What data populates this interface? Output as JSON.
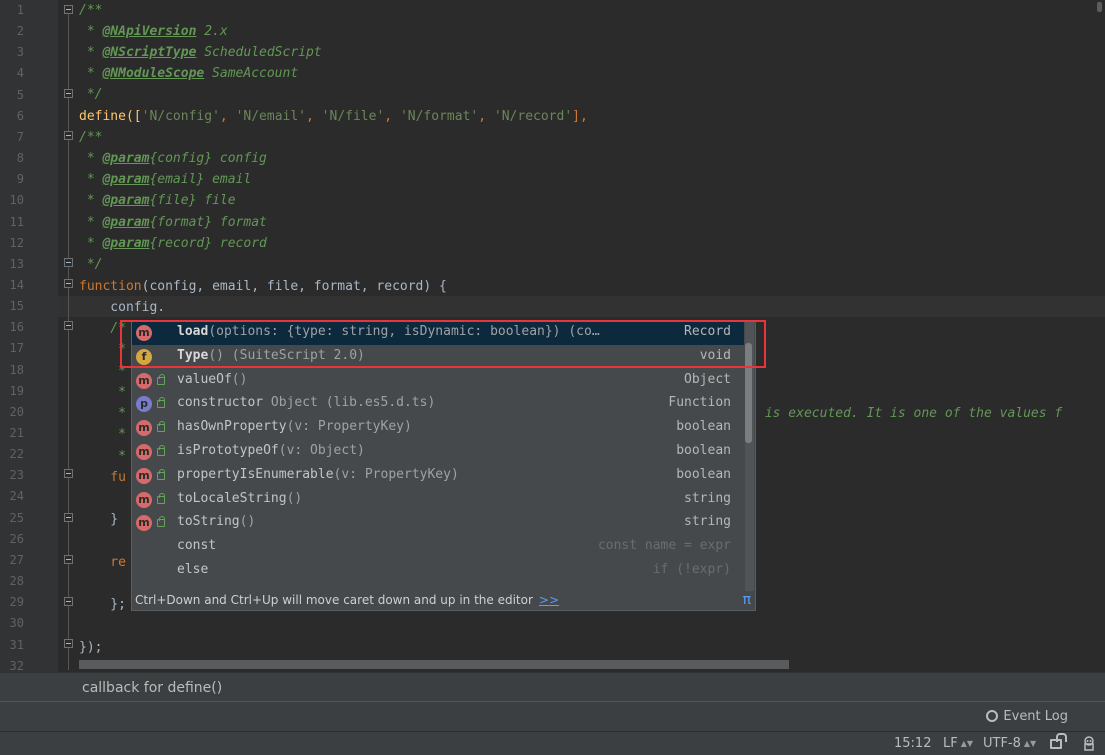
{
  "editor": {
    "line_numbers": [
      "1",
      "2",
      "3",
      "4",
      "5",
      "6",
      "7",
      "8",
      "9",
      "10",
      "11",
      "12",
      "13",
      "14",
      "15",
      "16",
      "17",
      "18",
      "19",
      "20",
      "21",
      "22",
      "23",
      "24",
      "25",
      "26",
      "27",
      "28",
      "29",
      "30",
      "31",
      "32"
    ],
    "code": {
      "l1": "/**",
      "l2_star": " * ",
      "l2_tag": "@NApiVersion",
      "l2_val": " 2.x",
      "l3_star": " * ",
      "l3_tag": "@NScriptType",
      "l3_val": " ScheduledScript",
      "l4_star": " * ",
      "l4_tag": "@NModuleScope",
      "l4_val": " SameAccount",
      "l5": " */",
      "l6_fn": "define([",
      "l6_s1": "'N/config'",
      "l6_s2": "'N/email'",
      "l6_s3": "'N/file'",
      "l6_s4": "'N/format'",
      "l6_s5": "'N/record'",
      "l6_sep": ", ",
      "l6_end": "],",
      "l7": "/**",
      "param_tag": "@param",
      "l8_rest": "{config} config",
      "l9_rest": "{email} email",
      "l10_rest": "{file} file",
      "l11_rest": "{format} format",
      "l12_rest": "{record} record",
      "l13": " */",
      "l14_kw": "function",
      "l14_rest": "(config, email, file, format, record) {",
      "l15": "    config.",
      "l16_frag": "    /*",
      "l17_frag": "     *",
      "l18_frag": "     *",
      "l19_frag": "     *",
      "l20_frag": "     *",
      "l20_right": " is executed. It is one of the values f",
      "l21_frag": "     *",
      "l22_frag": "     *",
      "l23_frag": "    fu",
      "l25_frag": "    }",
      "l27_frag": "    re",
      "l29_frag": "    };",
      "l31": "});"
    }
  },
  "completion": {
    "items": [
      {
        "icon": "m",
        "name": "load",
        "tail": "(options: {type: string, isDynamic: boolean}) (co…",
        "type": "Record"
      },
      {
        "icon": "f",
        "name": "Type",
        "tail": "() (SuiteScript 2.0)",
        "type": "void"
      },
      {
        "icon": "m",
        "name": "valueOf",
        "tail": "()",
        "type": "Object"
      },
      {
        "icon": "p",
        "name": "constructor",
        "tail": " Object (lib.es5.d.ts)",
        "type": "Function"
      },
      {
        "icon": "m",
        "name": "hasOwnProperty",
        "tail": "(v: PropertyKey)",
        "type": "boolean"
      },
      {
        "icon": "m",
        "name": "isPrototypeOf",
        "tail": "(v: Object)",
        "type": "boolean"
      },
      {
        "icon": "m",
        "name": "propertyIsEnumerable",
        "tail": "(v: PropertyKey)",
        "type": "boolean"
      },
      {
        "icon": "m",
        "name": "toLocaleString",
        "tail": "()",
        "type": "string"
      },
      {
        "icon": "m",
        "name": "toString",
        "tail": "()",
        "type": "string"
      },
      {
        "icon": "",
        "name": "const",
        "tail": "",
        "type": "const name = expr"
      },
      {
        "icon": "",
        "name": "else",
        "tail": "",
        "type": "if (!expr)"
      }
    ],
    "hint": "Ctrl+Down and Ctrl+Up will move caret down and up in the editor",
    "hint_link": ">>",
    "pi": "π"
  },
  "context_bar": {
    "text": "callback for define()"
  },
  "tool_window": {
    "event_log": "Event Log"
  },
  "status": {
    "position": "15:12",
    "line_sep": "LF",
    "encoding": "UTF-8"
  },
  "colors": {
    "keyword": "#cc7832",
    "string": "#6a8759",
    "doc": "#629755",
    "highlight": "#e8343b"
  }
}
